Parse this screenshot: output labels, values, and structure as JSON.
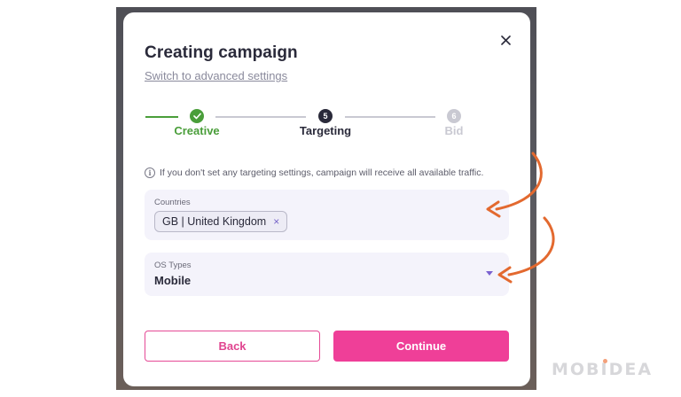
{
  "modal": {
    "title": "Creating campaign",
    "advanced_link": "Switch to advanced settings",
    "close_glyph": "×"
  },
  "stepper": {
    "steps": [
      {
        "number": "",
        "label": "Creative",
        "state": "completed",
        "color": "#4a9e3a"
      },
      {
        "number": "5",
        "label": "Targeting",
        "state": "active",
        "color": "#2a2a3a"
      },
      {
        "number": "6",
        "label": "Bid",
        "state": "upcoming",
        "color": "#c9c9d2"
      }
    ]
  },
  "info": {
    "icon": "info-icon",
    "icon_glyph": "i",
    "text": "If you don't set any targeting settings, campaign will receive all available traffic."
  },
  "countries": {
    "label": "Countries",
    "selected": [
      {
        "value": "GB | United Kingdom",
        "remove_glyph": "×"
      }
    ]
  },
  "os_types": {
    "label": "OS Types",
    "value": "Mobile"
  },
  "buttons": {
    "back": "Back",
    "continue": "Continue"
  },
  "watermark": {
    "text": "MOBIDEA"
  },
  "colors": {
    "accent_pink": "#ef3f98",
    "success_green": "#4a9e3a",
    "arrow_orange": "#e3692f",
    "field_bg": "#f4f3fb"
  }
}
